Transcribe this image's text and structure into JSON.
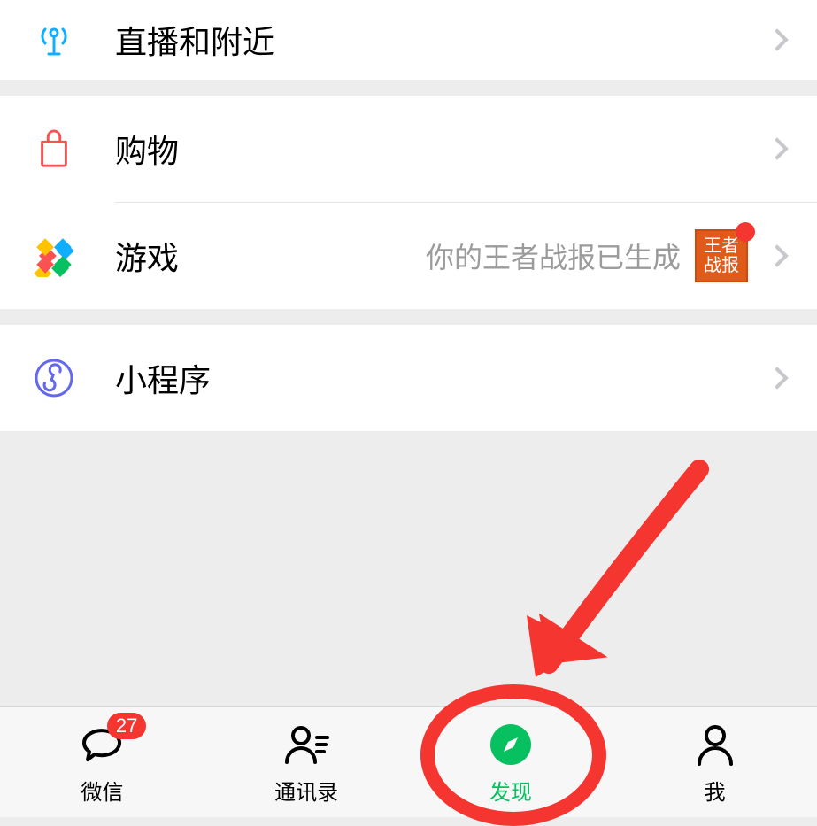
{
  "rows": {
    "live": {
      "label": "直播和附近"
    },
    "shopping": {
      "label": "购物"
    },
    "games": {
      "label": "游戏",
      "hint": "你的王者战报已生成",
      "thumb_line1": "王者",
      "thumb_line2": "战报"
    },
    "miniprogram": {
      "label": "小程序"
    }
  },
  "tabs": {
    "chat": {
      "label": "微信",
      "badge": "27"
    },
    "contacts": {
      "label": "通讯录"
    },
    "discover": {
      "label": "发现"
    },
    "me": {
      "label": "我"
    }
  }
}
